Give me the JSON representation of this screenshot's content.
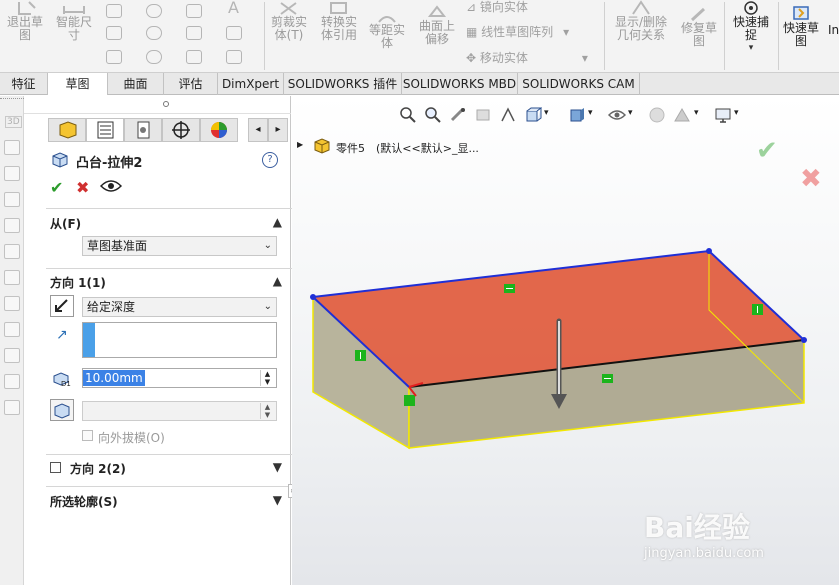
{
  "ribbon": {
    "exit_sketch": "退出草图",
    "smart_dimension": "智能尺寸",
    "trim_entities": "剪裁实体(T)",
    "convert_entities": "转换实体引用",
    "offset_entities": "等距实体",
    "surface_offset": "曲面上偏移",
    "mirror_entities": "镜向实体",
    "linear_pattern": "线性草图阵列",
    "move_entities": "移动实体",
    "show_delete_relations": "显示/删除几何关系",
    "repair_sketch": "修复草图",
    "quick_snap": "快速捕捉",
    "quick_sketch": "快速草图",
    "instant": "In"
  },
  "tabs": [
    "特征",
    "草图",
    "曲面",
    "评估",
    "DimXpert",
    "SOLIDWORKS 插件",
    "SOLIDWORKS MBD",
    "SOLIDWORKS CAM"
  ],
  "property_manager": {
    "title": "凸台-拉伸2",
    "from": {
      "label": "从(F)",
      "value": "草图基准面"
    },
    "direction1": {
      "label": "方向 1(1)",
      "end_condition": "给定深度",
      "depth": "10.00mm",
      "draft_outward": "向外拔模(O)"
    },
    "direction2": {
      "label": "方向 2(2)"
    },
    "selected_contours": {
      "label": "所选轮廓(S)"
    }
  },
  "tree": {
    "part": "零件5",
    "config": "(默认<<默认>_显..."
  },
  "watermark": {
    "brand": "Bai经验",
    "url": "jingyan.baidu.com"
  },
  "colors": {
    "face": "#e05a3c",
    "edge_blue": "#1f2fd6",
    "edge_yellow": "#f2e800",
    "side": "#b8b49c",
    "ok": "#2c9c2c",
    "cancel": "#d03030"
  }
}
